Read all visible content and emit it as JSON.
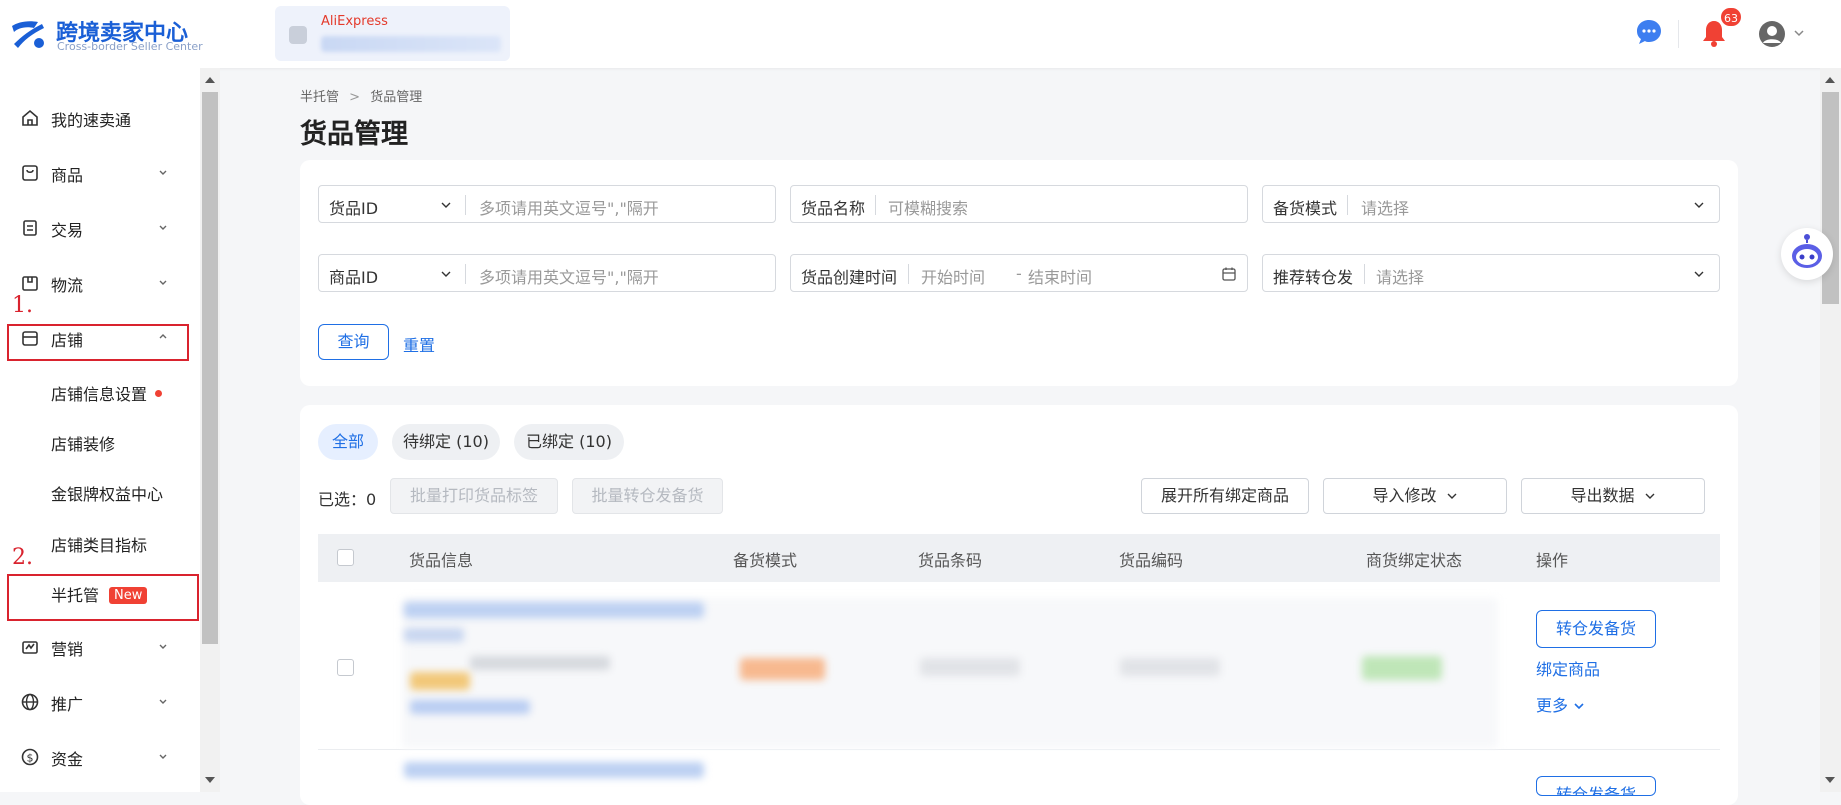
{
  "brand": {
    "title": "跨境卖家中心",
    "subtitle": "Cross-border Seller Center",
    "color": "#1a5fd6"
  },
  "store": {
    "platform": "AliExpress"
  },
  "header": {
    "notification_count": "63",
    "icons": [
      "chat-icon",
      "bell-icon",
      "user-icon",
      "chevron-down-icon"
    ]
  },
  "sidebar": {
    "items": [
      {
        "label": "我的速卖通",
        "icon": "home-icon"
      },
      {
        "label": "商品",
        "icon": "product-icon"
      },
      {
        "label": "交易",
        "icon": "order-icon"
      },
      {
        "label": "物流",
        "icon": "logistics-icon"
      },
      {
        "label": "店铺",
        "icon": "store-icon"
      },
      {
        "label": "营销",
        "icon": "marketing-icon"
      },
      {
        "label": "推广",
        "icon": "globe-icon"
      },
      {
        "label": "资金",
        "icon": "money-icon"
      }
    ],
    "store_sub": [
      "店铺信息设置",
      "店铺装修",
      "金银牌权益中心",
      "店铺类目指标",
      "半托管"
    ],
    "new_tag": "New"
  },
  "annotations": {
    "step1": "1.",
    "step2": "2."
  },
  "breadcrumb": {
    "root": "半托管",
    "sep": ">",
    "current": "货品管理"
  },
  "page_title": "货品管理",
  "filters": {
    "goods_id_label": "货品ID",
    "goods_id_placeholder": "多项请用英文逗号\",\"隔开",
    "goods_name_label": "货品名称",
    "goods_name_placeholder": "可模糊搜索",
    "stock_mode_label": "备货模式",
    "stock_mode_placeholder": "请选择",
    "product_id_label": "商品ID",
    "product_id_placeholder": "多项请用英文逗号\",\"隔开",
    "create_time_label": "货品创建时间",
    "start_placeholder": "开始时间",
    "range_sep": "-",
    "end_placeholder": "结束时间",
    "transfer_label": "推荐转仓发",
    "transfer_placeholder": "请选择",
    "query": "查询",
    "reset": "重置"
  },
  "tabs": {
    "all": "全部",
    "pending": "待绑定 (10)",
    "bound": "已绑定 (10)"
  },
  "toolbar": {
    "selected": "已选：0",
    "batch_print": "批量打印货品标签",
    "batch_transfer": "批量转仓发备货",
    "expand_all": "展开所有绑定商品",
    "import": "导入修改",
    "export": "导出数据"
  },
  "table": {
    "columns": [
      "货品信息",
      "备货模式",
      "货品条码",
      "货品编码",
      "商货绑定状态",
      "操作"
    ],
    "row_actions": {
      "transfer": "转仓发备货",
      "bind": "绑定商品",
      "more": "更多"
    }
  }
}
